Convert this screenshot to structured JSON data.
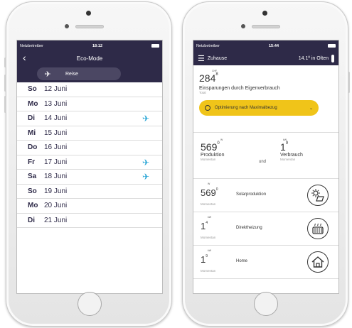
{
  "left_phone": {
    "status": {
      "carrier": "Netzbetreiber",
      "time": "18:12"
    },
    "nav": {
      "title": "Eco-Mode",
      "back_icon": "chevron-left-icon"
    },
    "filter": {
      "label": "Reise",
      "icon": "airplane-icon"
    },
    "days": [
      {
        "dow": "So",
        "date": "12 Juni",
        "travel": false
      },
      {
        "dow": "Mo",
        "date": "13 Juni",
        "travel": false
      },
      {
        "dow": "Di",
        "date": "14 Juni",
        "travel": true
      },
      {
        "dow": "Mi",
        "date": "15 Juni",
        "travel": false
      },
      {
        "dow": "Do",
        "date": "16 Juni",
        "travel": false
      },
      {
        "dow": "Fr",
        "date": "17 Juni",
        "travel": true
      },
      {
        "dow": "Sa",
        "date": "18 Juni",
        "travel": true
      },
      {
        "dow": "So",
        "date": "19 Juni",
        "travel": false
      },
      {
        "dow": "Mo",
        "date": "20 Juni",
        "travel": false
      },
      {
        "dow": "Di",
        "date": "21 Juni",
        "travel": false
      }
    ],
    "accent_color": "#2aa6d6",
    "header_color": "#2e2a48"
  },
  "right_phone": {
    "status": {
      "carrier": "Netzbetreiber",
      "time": "15:44"
    },
    "nav": {
      "title": "Zuhause",
      "weather": "14.1º in Olten"
    },
    "savings": {
      "unit": "CHF",
      "value": "284",
      "decimal": "8",
      "label": "Einsparungen durch Eigenverbrauch",
      "sublabel": "Total",
      "button": "Optimierung nach Maximalbezug"
    },
    "production": {
      "unit": "W",
      "value": "569",
      "decimal": "0",
      "label": "Produktion",
      "sublabel": "Momentan"
    },
    "connector": "und",
    "consumption": {
      "unit": "kW",
      "value": "1",
      "decimal": "9",
      "label": "Verbrauch",
      "sublabel": "Momentan"
    },
    "devices": [
      {
        "unit": "W",
        "value": "569",
        "decimal": "0",
        "sublabel": "Momentan",
        "name": "Solarproduktion",
        "icon": "solar-panel-icon"
      },
      {
        "unit": "kW",
        "value": "1",
        "decimal": "4",
        "sublabel": "Momentan",
        "name": "Direktheizung",
        "icon": "heater-icon"
      },
      {
        "unit": "kW",
        "value": "1",
        "decimal": "9",
        "sublabel": "Momentan",
        "name": "Home",
        "icon": "house-icon"
      }
    ],
    "button_color": "#f0c419"
  }
}
